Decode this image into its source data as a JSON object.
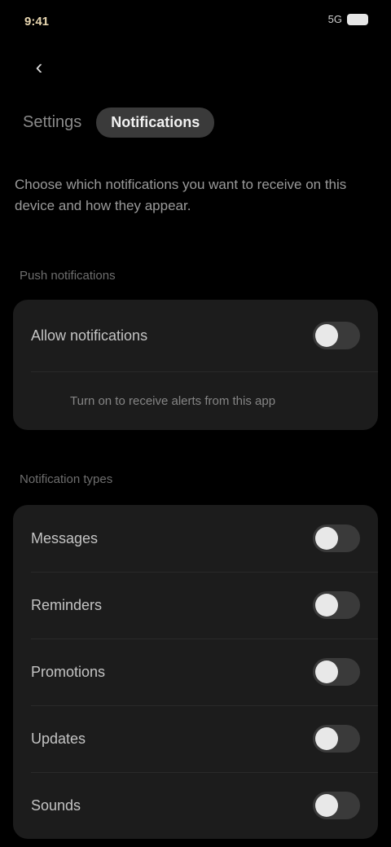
{
  "status_bar": {
    "time": "9:41",
    "signal": "5G"
  },
  "nav": {
    "back_glyph": "‹"
  },
  "header": {
    "label": "Settings",
    "pill": "Notifications"
  },
  "description": "Choose which notifications you want to receive on this device and how they appear.",
  "section_main": {
    "title": "Push notifications",
    "row": {
      "label": "Allow notifications",
      "sublabel": "Turn on to receive alerts from this app"
    }
  },
  "section_types": {
    "title": "Notification types",
    "rows": [
      {
        "label": "Messages"
      },
      {
        "label": "Reminders"
      },
      {
        "label": "Promotions"
      },
      {
        "label": "Updates"
      },
      {
        "label": "Sounds"
      }
    ]
  },
  "colors": {
    "background": "#000000",
    "card": "#1c1c1c",
    "toggle_off": "#3a3a3a",
    "knob": "#e8e8e8"
  }
}
